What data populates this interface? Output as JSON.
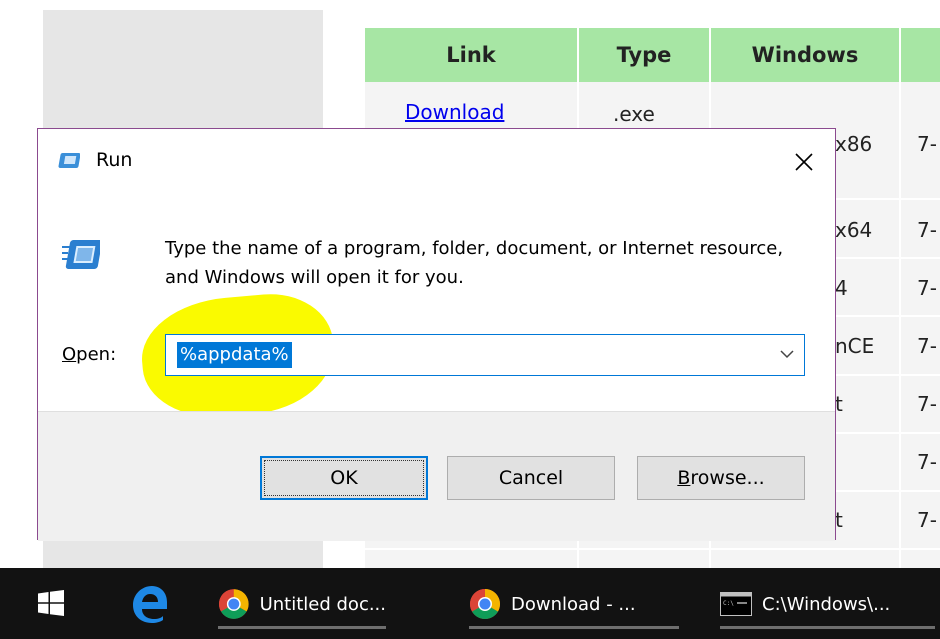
{
  "background_page": {
    "table": {
      "headers": [
        "Link",
        "Type",
        "Windows",
        ""
      ],
      "rows": [
        {
          "link": "Download",
          "type": ".exe",
          "windows": "x86",
          "size": "7-"
        },
        {
          "link": "",
          "type": "",
          "windows": "x64",
          "size": "7-"
        },
        {
          "link": "",
          "type": "",
          "windows": "4",
          "size": "7-"
        },
        {
          "link": "",
          "type": "",
          "windows": "nCE",
          "size": "7-"
        },
        {
          "link": "",
          "type": "",
          "windows": "t",
          "size": "7-"
        },
        {
          "link": "",
          "type": "",
          "windows": "",
          "size": "7-"
        },
        {
          "link": "",
          "type": "",
          "windows": "t",
          "size": "7-"
        }
      ]
    }
  },
  "dialog": {
    "title": "Run",
    "close_icon": "close-icon",
    "description": "Type the name of a program, folder, document, or Internet resource, and Windows will open it for you.",
    "open_label": "Open:",
    "open_value": "%appdata%",
    "buttons": {
      "ok": "OK",
      "cancel": "Cancel",
      "browse": "Browse..."
    },
    "highlight_color": "#fafa00",
    "accent": "#0078d7"
  },
  "taskbar": {
    "start_icon": "windows-logo-icon",
    "pinned": [
      {
        "icon": "edge-icon"
      }
    ],
    "items": [
      {
        "icon": "chrome-icon",
        "label": "Untitled doc..."
      },
      {
        "icon": "chrome-icon",
        "label": "Download - ..."
      },
      {
        "icon": "cmd-icon",
        "label": "C:\\Windows\\..."
      }
    ]
  }
}
